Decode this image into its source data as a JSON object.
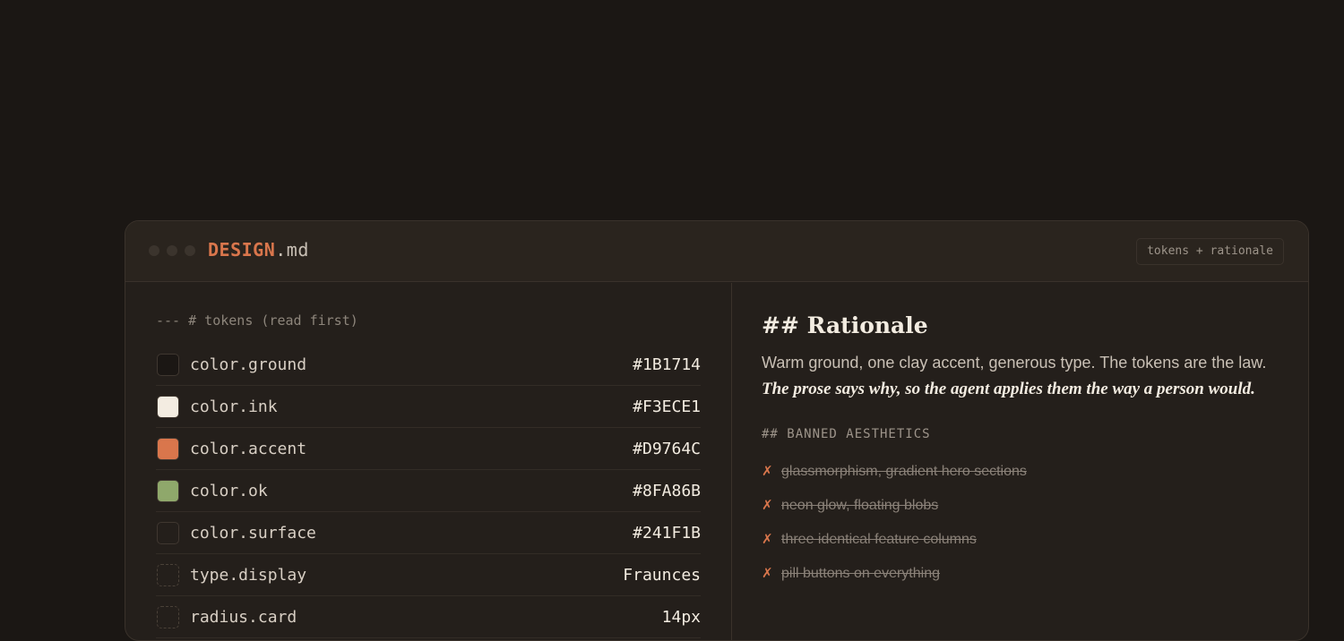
{
  "window": {
    "file_name": "DESIGN",
    "file_ext": ".md",
    "badge": "tokens + rationale"
  },
  "tokens": {
    "comment": "--- # tokens (read first)",
    "items": [
      {
        "name": "color.ground",
        "value": "#1B1714",
        "swatch": "#1b1714",
        "swatch_style": "solid"
      },
      {
        "name": "color.ink",
        "value": "#F3ECE1",
        "swatch": "#f3ece1",
        "swatch_style": "solid"
      },
      {
        "name": "color.accent",
        "value": "#D9764C",
        "swatch": "#d9764c",
        "swatch_style": "solid"
      },
      {
        "name": "color.ok",
        "value": "#8FA86B",
        "swatch": "#8fa86b",
        "swatch_style": "solid"
      },
      {
        "name": "color.surface",
        "value": "#241F1B",
        "swatch": "#241f1b",
        "swatch_style": "solid"
      },
      {
        "name": "type.display",
        "value": "Fraunces",
        "swatch": "",
        "swatch_style": "dashed"
      },
      {
        "name": "radius.card",
        "value": "14px",
        "swatch": "",
        "swatch_style": "dashed"
      }
    ]
  },
  "rationale": {
    "heading": "## Rationale",
    "prose_plain": "Warm ground, one clay accent, generous type. The tokens are the law. ",
    "prose_emphasis": "The prose says why, so the agent applies them the way a person would.",
    "banned_heading": "## BANNED AESTHETICS",
    "banned_mark": "✗",
    "banned": [
      "glassmorphism, gradient hero sections",
      "neon glow, floating blobs",
      "three identical feature columns",
      "pill buttons on everything"
    ]
  },
  "colors": {
    "background": "#1b1714",
    "surface": "#241f1b",
    "accent": "#d9764c",
    "ink": "#f3ece1"
  }
}
